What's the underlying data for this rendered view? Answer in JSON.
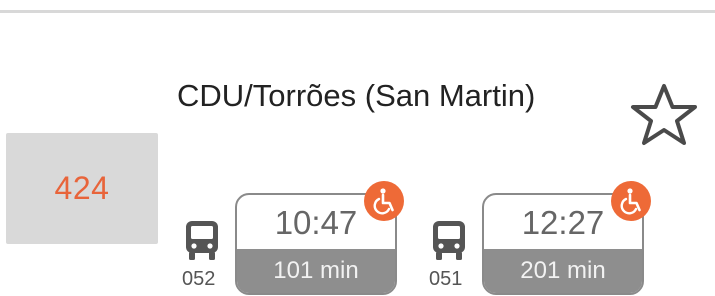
{
  "route": {
    "number": "424"
  },
  "stop": {
    "name": "CDU/Torrões (San Martin)"
  },
  "favorite": {
    "icon": "star-outline-icon"
  },
  "departures": [
    {
      "bus": "052",
      "time": "10:47",
      "duration": "101 min",
      "accessible": true
    },
    {
      "bus": "051",
      "time": "12:27",
      "duration": "201 min",
      "accessible": true
    }
  ],
  "colors": {
    "accent": "#e8643a",
    "badge_bg": "#d9d9d9",
    "duration_bg": "#8e8e8e",
    "accessibility_badge": "#ee6a37"
  }
}
